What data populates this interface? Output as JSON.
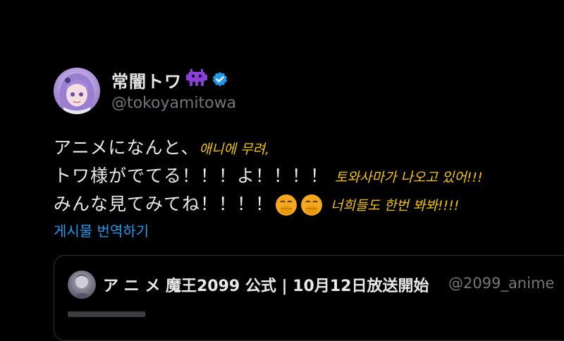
{
  "author": {
    "display_name": "常闇トワ",
    "handle": "@tokoyamitowa",
    "verified_icon": "verified-badge-icon",
    "name_emoji_icon": "purple-invader-emoji-icon"
  },
  "tweet": {
    "lines": [
      {
        "text": "アニメになんと、",
        "subtitle": "애니에 무려,"
      },
      {
        "text": "トワ様がでてる！！！よ！！！！",
        "subtitle": "토와사마가 나오고 있어!!!"
      },
      {
        "text": "みんな見てみてね！！！！",
        "subtitle": "너희들도 한번 봐봐!!!!"
      }
    ],
    "emoji_icon": "face-with-hand-over-mouth-emoji-icon",
    "translate_label": "게시물 번역하기"
  },
  "quote": {
    "title": "ア ニ メ 魔王2099 公式 | 10月12日放送開始",
    "handle": "@2099_anime"
  },
  "colors": {
    "background": "#000000",
    "text": "#e7e9ea",
    "muted": "#71767b",
    "link": "#1d9bf0",
    "subtitle": "#f5c400",
    "verified": "#1d9bf0"
  }
}
